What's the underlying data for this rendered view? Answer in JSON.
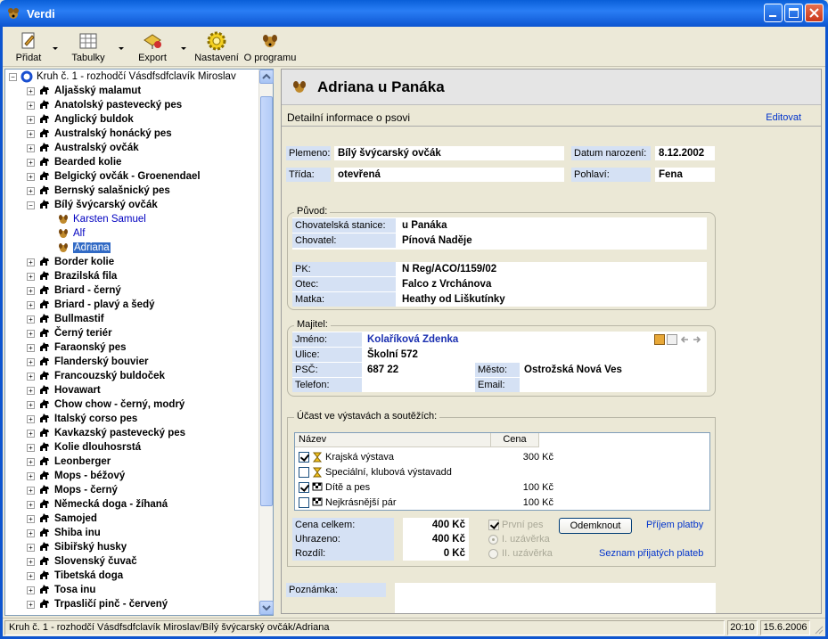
{
  "window": {
    "title": "Verdi"
  },
  "toolbar": {
    "add": "Přidat",
    "tables": "Tabulky",
    "export": "Export",
    "settings": "Nastavení",
    "about": "O programu"
  },
  "tree": {
    "root": "Kruh č. 1 - rozhodčí Vásdfsdfclavík Miroslav",
    "breeds": [
      "Aljašský malamut",
      "Anatolský pastevecký pes",
      "Anglický buldok",
      "Australský honácký pes",
      "Australský ovčák",
      "Bearded kolie",
      "Belgický ovčák - Groenendael",
      "Bernský salašnický pes",
      "Bílý švýcarský ovčák",
      "Border kolie",
      "Brazilská fila",
      "Briard - černý",
      "Briard - plavý a šedý",
      "Bullmastif",
      "Černý teriér",
      "Faraonský pes",
      "Flanderský bouvier",
      "Francouzský buldoček",
      "Hovawart",
      "Chow chow - černý, modrý",
      "Italský corso pes",
      "Kavkazský pastevecký pes",
      "Kolie dlouhosrstá",
      "Leonberger",
      "Mops - béžový",
      "Mops - černý",
      "Německá doga - žíhaná",
      "Samojed",
      "Shiba inu",
      "Sibiřský husky",
      "Slovenský čuvač",
      "Tibetská doga",
      "Tosa inu",
      "Trpasličí pinč - červený"
    ],
    "children": [
      "Karsten Samuel",
      "Alf",
      "Adriana"
    ]
  },
  "detail": {
    "dog_name": "Adriana u Panáka",
    "section_title": "Detailní informace o psovi",
    "edit_link": "Editovat",
    "breed_label": "Plemeno:",
    "breed_value": "Bílý švýcarský ovčák",
    "birth_label": "Datum narození:",
    "birth_value": "8.12.2002",
    "class_label": "Třída:",
    "class_value": "otevřená",
    "sex_label": "Pohlaví:",
    "sex_value": "Fena",
    "origin": {
      "legend": "Původ:",
      "kennel_label": "Chovatelská stanice:",
      "kennel_value": "u Panáka",
      "breeder_label": "Chovatel:",
      "breeder_value": "Pínová Naděje",
      "pk_label": "PK:",
      "pk_value": "N Reg/ACO/1159/02",
      "father_label": "Otec:",
      "father_value": "Falco z Vrchánova",
      "mother_label": "Matka:",
      "mother_value": "Heathy od Liškutínky"
    },
    "owner": {
      "legend": "Majitel:",
      "name_label": "Jméno:",
      "name_value": "Kolaříková Zdenka",
      "street_label": "Ulice:",
      "street_value": "Školní 572",
      "zip_label": "PSČ:",
      "zip_value": "687 22",
      "city_label": "Město:",
      "city_value": "Ostrožská Nová Ves",
      "phone_label": "Telefon:",
      "phone_value": "",
      "email_label": "Email:",
      "email_value": ""
    },
    "shows": {
      "legend": "Účast ve výstavách a soutěžích:",
      "col_name": "Název",
      "col_price": "Cena",
      "rows": [
        {
          "name": "Krajská výstava",
          "price": "300 Kč",
          "checked": true,
          "icon": "hourglass-icon"
        },
        {
          "name": "Speciální, klubová výstavadd",
          "price": "",
          "checked": false,
          "icon": "hourglass-icon"
        },
        {
          "name": "Dítě a pes",
          "price": "100 Kč",
          "checked": true,
          "icon": "checkered-flag-icon"
        },
        {
          "name": "Nejkrásnější pár",
          "price": "100 Kč",
          "checked": false,
          "icon": "checkered-flag-icon"
        }
      ],
      "total_label": "Cena celkem:",
      "total_value": "400 Kč",
      "paid_label": "Uhrazeno:",
      "paid_value": "400 Kč",
      "diff_label": "Rozdíl:",
      "diff_value": "0 Kč",
      "first_dog": "První pes",
      "close1": "I. uzávěrka",
      "close2": "II. uzávěrka",
      "unlock_button": "Odemknout",
      "receive_payment": "Příjem platby",
      "payment_list": "Seznam přijatých plateb"
    },
    "note_label": "Poznámka:"
  },
  "status": {
    "path": "Kruh č. 1 - rozhodčí Vásdfsdfclavík Miroslav/Bílý švýcarský ovčák/Adriana",
    "time": "20:10",
    "date": "15.6.2006"
  },
  "colors": {
    "accent": "#0a5fd8",
    "label_bg": "#d5e1f4",
    "link": "#0033cc",
    "selection": "#316ac5"
  }
}
